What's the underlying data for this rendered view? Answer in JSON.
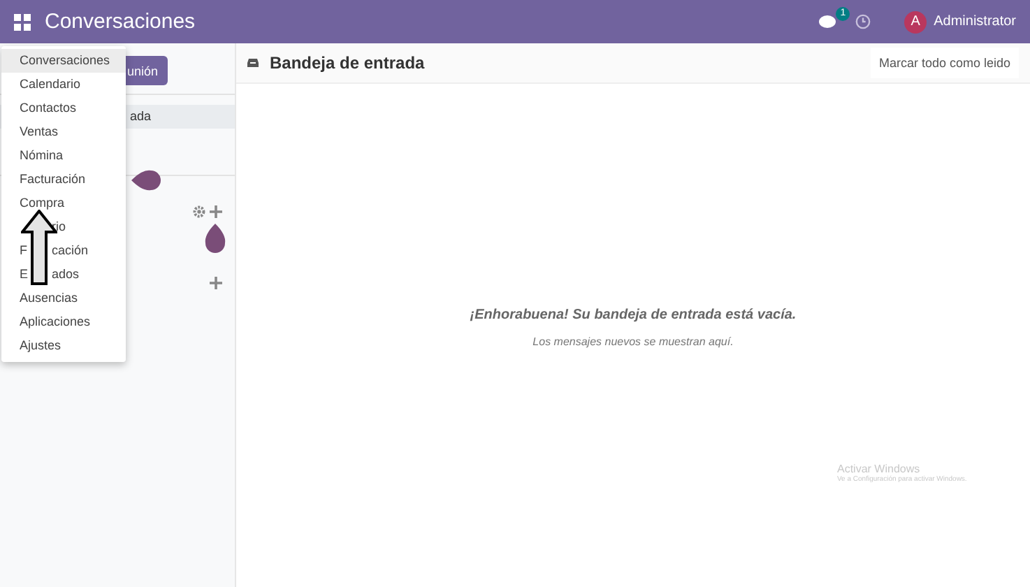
{
  "navbar": {
    "app_title": "Conversaciones",
    "message_count": "1",
    "user_initial": "A",
    "user_name": "Administrator"
  },
  "sidebar": {
    "meeting_button": "unión",
    "inbox_item": {
      "label": "ada",
      "selected": true
    }
  },
  "app_menu": {
    "items": [
      {
        "kind": "full",
        "label": "Conversaciones",
        "selected": true
      },
      {
        "kind": "full",
        "label": "Calendario",
        "selected": false
      },
      {
        "kind": "full",
        "label": "Contactos",
        "selected": false
      },
      {
        "kind": "full",
        "label": "Ventas",
        "selected": false
      },
      {
        "kind": "full",
        "label": "Nómina",
        "selected": false
      },
      {
        "kind": "full",
        "label": "Facturación",
        "selected": false
      },
      {
        "kind": "full",
        "label": "Compra",
        "selected": false
      },
      {
        "kind": "covered",
        "after": "rio",
        "selected": false
      },
      {
        "kind": "covered",
        "before": "F",
        "after": "cación",
        "selected": false
      },
      {
        "kind": "covered",
        "before": "E",
        "after": "ados",
        "selected": false
      },
      {
        "kind": "full",
        "label": "Ausencias",
        "selected": false
      },
      {
        "kind": "full",
        "label": "Aplicaciones",
        "selected": false
      },
      {
        "kind": "full",
        "label": "Ajustes",
        "selected": false
      }
    ]
  },
  "content": {
    "title": "Bandeja de entrada",
    "mark_all_button": "Marcar todo como leido",
    "empty_title": "¡Enhorabuena! Su bandeja de entrada está vacía.",
    "empty_subtitle": "Los mensajes nuevos se muestran aquí."
  },
  "os_notice": {
    "title": "Activar Windows",
    "subtitle": "Ve a Configuración para activar Windows."
  }
}
